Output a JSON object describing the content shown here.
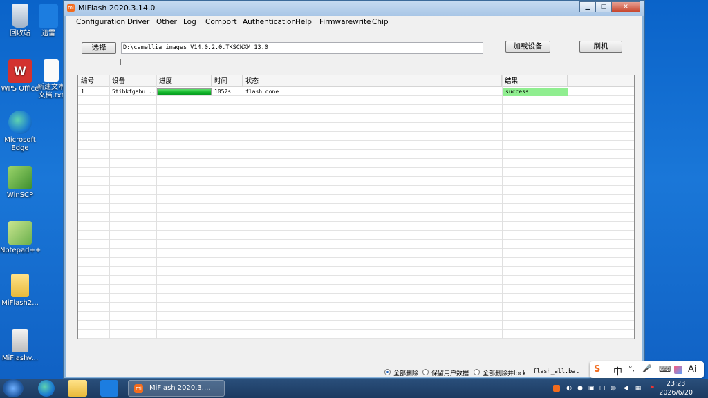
{
  "desktop": {
    "icons": [
      {
        "label": "回收站"
      },
      {
        "label": "迅雷"
      },
      {
        "label": "WPS Office"
      },
      {
        "label": "新建文本文档.txt"
      },
      {
        "label": "Microsoft Edge"
      },
      {
        "label": "WinSCP"
      },
      {
        "label": "Notepad++"
      },
      {
        "label": "MiFlash2..."
      },
      {
        "label": "MiFlashv..."
      }
    ]
  },
  "window": {
    "title": "MiFlash 2020.3.14.0",
    "app_icon_text": "mi",
    "buttons": {
      "minimize": "▁",
      "maximize": "□",
      "close": "✕"
    }
  },
  "menu": [
    "Configuration",
    "Driver",
    "Other",
    "Log",
    "Comport",
    "Authentication",
    "Help",
    "Firmwarewrite",
    "Chip"
  ],
  "toolbar": {
    "select_label": "选择",
    "path_value": "D:\\camellia_images_V14.0.2.0.TKSCNXM_13.0",
    "load_device_label": "加载设备",
    "flash_label": "刷机"
  },
  "grid": {
    "columns": [
      "编号",
      "设备",
      "进度",
      "时间",
      "状态",
      "结果"
    ],
    "rows": [
      {
        "index": "1",
        "device": "5tibkfgabu...",
        "progress": 1.0,
        "time": "1052s",
        "status": "flash done",
        "result": "success"
      }
    ]
  },
  "flash_options": {
    "option_clean_all": "全部删除",
    "option_save_user": "保留用户数据",
    "option_clean_lock": "全部删除并lock",
    "selected": "全部删除",
    "script": "flash_all.bat"
  },
  "ime": {
    "logo": "S",
    "lang": "中",
    "punct": "°,",
    "mic": "🎤",
    "keyboard": "⌨",
    "ai": "Ai"
  },
  "taskbar": {
    "active_task": "MiFlash 2020.3....",
    "time": "23:23",
    "date": "2026/6/20"
  },
  "colors": {
    "success_bg": "#90ee90",
    "progress": "#12b42a",
    "desktop_bg": "#1a77d8"
  }
}
